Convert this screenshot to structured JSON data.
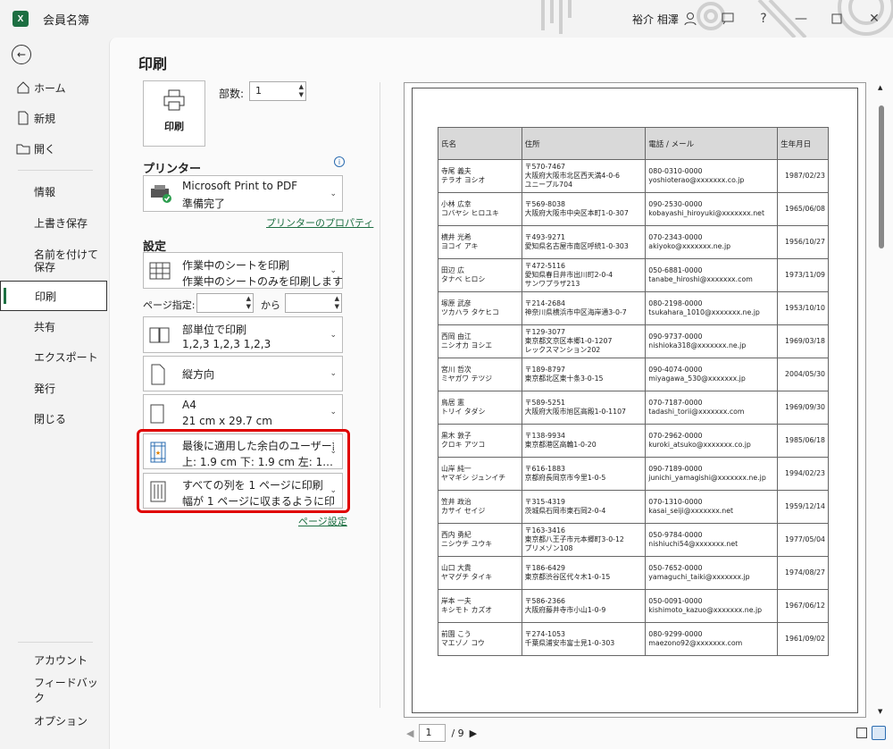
{
  "app": {
    "title": "会員名簿",
    "user": "裕介 相澤",
    "logo": "X"
  },
  "nav": {
    "items": [
      {
        "label": "ホーム",
        "icon": "home-icon"
      },
      {
        "label": "新規",
        "icon": "new-file-icon"
      },
      {
        "label": "開く",
        "icon": "folder-icon"
      },
      {
        "label": "情報"
      },
      {
        "label": "上書き保存"
      },
      {
        "label": "名前を付けて保存"
      },
      {
        "label": "印刷"
      },
      {
        "label": "共有"
      },
      {
        "label": "エクスポート"
      },
      {
        "label": "発行"
      },
      {
        "label": "閉じる"
      },
      {
        "label": "アカウント"
      },
      {
        "label": "フィードバック"
      },
      {
        "label": "オプション"
      }
    ]
  },
  "print": {
    "title": "印刷",
    "print_button": "印刷",
    "copies_label": "部数:",
    "copies_value": "1",
    "printer_heading": "プリンター",
    "printer_name": "Microsoft Print to PDF",
    "printer_status": "準備完了",
    "printer_props": "プリンターのプロパティ",
    "settings_heading": "設定",
    "what": {
      "l1": "作業中のシートを印刷",
      "l2": "作業中のシートのみを印刷します"
    },
    "pages_label": "ページ指定:",
    "pages_to": "から",
    "collate": {
      "l1": "部単位で印刷",
      "l2": "1,2,3    1,2,3    1,2,3"
    },
    "orientation": "縦方向",
    "paper": {
      "l1": "A4",
      "l2": "21 cm x 29.7 cm"
    },
    "margins": {
      "l1": "最後に適用した余白のユーザー設定",
      "l2": "上: 1.9 cm 下: 1.9 cm 左: 1.…"
    },
    "scaling": {
      "l1": "すべての列を 1 ページに印刷",
      "l2": "幅が 1 ページに収まるように印刷イ…"
    },
    "page_setup": "ページ設定"
  },
  "preview": {
    "headers": [
      "氏名",
      "住所",
      "電話 / メール",
      "生年月日"
    ],
    "rows": [
      {
        "n1": "寺尾 義夫",
        "n2": "テラオ ヨシオ",
        "a1": "〒570-7467",
        "a2": "大阪府大阪市北区西天満4-0-6",
        "a3": "ユニープル704",
        "t1": "080-0310-0000",
        "t2": "yoshioterao@xxxxxxx.co.jp",
        "d": "1987/02/23"
      },
      {
        "n1": "小林 広幸",
        "n2": "コバヤシ ヒロユキ",
        "a1": "〒569-8038",
        "a2": "大阪府大阪市中央区本町1-0-307",
        "a3": "",
        "t1": "090-2530-0000",
        "t2": "kobayashi_hiroyuki@xxxxxxx.net",
        "d": "1965/06/08"
      },
      {
        "n1": "横井 光希",
        "n2": "ヨコイ アキ",
        "a1": "〒493-9271",
        "a2": "愛知県名古屋市南区呼続1-0-303",
        "a3": "",
        "t1": "070-2343-0000",
        "t2": "akiyoko@xxxxxxx.ne.jp",
        "d": "1956/10/27"
      },
      {
        "n1": "田辺 広",
        "n2": "タナベ ヒロシ",
        "a1": "〒472-5116",
        "a2": "愛知県春日井市出川町2-0-4",
        "a3": "サンワプラザ213",
        "t1": "050-6881-0000",
        "t2": "tanabe_hiroshi@xxxxxxx.com",
        "d": "1973/11/09"
      },
      {
        "n1": "塚原 武彦",
        "n2": "ツカハラ タケヒコ",
        "a1": "〒214-2684",
        "a2": "神奈川県横浜市中区海岸通3-0-7",
        "a3": "",
        "t1": "080-2198-0000",
        "t2": "tsukahara_1010@xxxxxxx.ne.jp",
        "d": "1953/10/10"
      },
      {
        "n1": "西岡 由江",
        "n2": "ニシオカ ヨシエ",
        "a1": "〒129-3077",
        "a2": "東京都文京区本郷1-0-1207",
        "a3": "レックスマンション202",
        "t1": "090-9737-0000",
        "t2": "nishioka318@xxxxxxx.ne.jp",
        "d": "1969/03/18"
      },
      {
        "n1": "宮川 哲次",
        "n2": "ミヤガワ テツジ",
        "a1": "〒189-8797",
        "a2": "東京都北区東十条3-0-15",
        "a3": "",
        "t1": "090-4074-0000",
        "t2": "miyagawa_530@xxxxxxx.jp",
        "d": "2004/05/30"
      },
      {
        "n1": "鳥居 憲",
        "n2": "トリイ タダシ",
        "a1": "〒589-5251",
        "a2": "大阪府大阪市旭区高殿1-0-1107",
        "a3": "",
        "t1": "070-7187-0000",
        "t2": "tadashi_torii@xxxxxxx.com",
        "d": "1969/09/30"
      },
      {
        "n1": "黒木 敦子",
        "n2": "クロキ アツコ",
        "a1": "〒138-9934",
        "a2": "東京都港区高輪1-0-20",
        "a3": "",
        "t1": "070-2962-0000",
        "t2": "kuroki_atsuko@xxxxxxx.co.jp",
        "d": "1985/06/18"
      },
      {
        "n1": "山岸 純一",
        "n2": "ヤマギシ ジュンイチ",
        "a1": "〒616-1883",
        "a2": "京都府長岡京市今里1-0-5",
        "a3": "",
        "t1": "090-7189-0000",
        "t2": "junichi_yamagishi@xxxxxxx.ne.jp",
        "d": "1994/02/23"
      },
      {
        "n1": "笠井 政治",
        "n2": "カサイ セイジ",
        "a1": "〒315-4319",
        "a2": "茨城県石岡市東石岡2-0-4",
        "a3": "",
        "t1": "070-1310-0000",
        "t2": "kasai_seiji@xxxxxxx.net",
        "d": "1959/12/14"
      },
      {
        "n1": "西内 勇紀",
        "n2": "ニシウチ ユウキ",
        "a1": "〒163-3416",
        "a2": "東京都八王子市元本郷町3-0-12",
        "a3": "プリメゾン108",
        "t1": "050-9784-0000",
        "t2": "nishiuchi54@xxxxxxx.net",
        "d": "1977/05/04"
      },
      {
        "n1": "山口 大貴",
        "n2": "ヤマグチ タイキ",
        "a1": "〒186-6429",
        "a2": "東京都渋谷区代々木1-0-15",
        "a3": "",
        "t1": "050-7652-0000",
        "t2": "yamaguchi_taiki@xxxxxxx.jp",
        "d": "1974/08/27"
      },
      {
        "n1": "岸本 一夫",
        "n2": "キシモト カズオ",
        "a1": "〒586-2366",
        "a2": "大阪府藤井寺市小山1-0-9",
        "a3": "",
        "t1": "050-0091-0000",
        "t2": "kishimoto_kazuo@xxxxxxx.ne.jp",
        "d": "1967/06/12"
      },
      {
        "n1": "前園 こう",
        "n2": "マエゾノ コウ",
        "a1": "〒274-1053",
        "a2": "千葉県浦安市富士見1-0-303",
        "a3": "",
        "t1": "080-9299-0000",
        "t2": "maezono92@xxxxxxx.com",
        "d": "1961/09/02"
      }
    ],
    "page_current": "1",
    "page_total": "/ 9"
  }
}
